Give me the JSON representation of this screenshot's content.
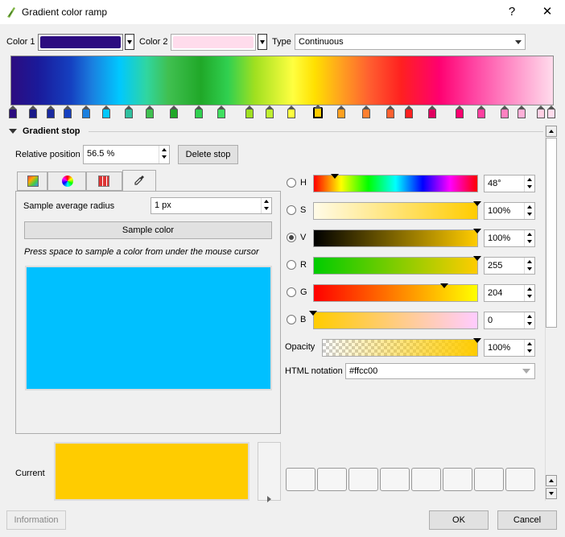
{
  "window": {
    "title": "Gradient color ramp",
    "help_label": "?",
    "close_label": "✕"
  },
  "top_row": {
    "color1_label": "Color 1",
    "color1_value": "#2c0c80",
    "color2_label": "Color 2",
    "color2_value": "#ffdcec",
    "type_label": "Type",
    "type_value": "Continuous"
  },
  "gradient_stop": {
    "section_label": "Gradient stop",
    "relative_position_label": "Relative position",
    "relative_position_value": "56.5 %",
    "delete_stop_label": "Delete stop"
  },
  "sampler": {
    "radius_label": "Sample average radius",
    "radius_value": "1 px",
    "sample_color_label": "Sample color",
    "hint": "Press space to sample a color from under the mouse cursor",
    "sampled_color": "#00c0ff"
  },
  "channels": {
    "H": {
      "label": "H",
      "value": "48°"
    },
    "S": {
      "label": "S",
      "value": "100%"
    },
    "V": {
      "label": "V",
      "value": "100%"
    },
    "R": {
      "label": "R",
      "value": "255"
    },
    "G": {
      "label": "G",
      "value": "204"
    },
    "B": {
      "label": "B",
      "value": "0"
    },
    "opacity": {
      "label": "Opacity",
      "value": "100%"
    },
    "selected": "V"
  },
  "html_notation": {
    "label": "HTML notation",
    "value": "#ffcc00"
  },
  "current": {
    "label": "Current",
    "color": "#ffcc00"
  },
  "footer": {
    "information_label": "Information",
    "ok_label": "OK",
    "cancel_label": "Cancel"
  },
  "icons": [
    "qgis-gradient-icon",
    "palette-icon",
    "color-wheel-icon",
    "swatch-grid-icon",
    "eyedropper-icon"
  ]
}
